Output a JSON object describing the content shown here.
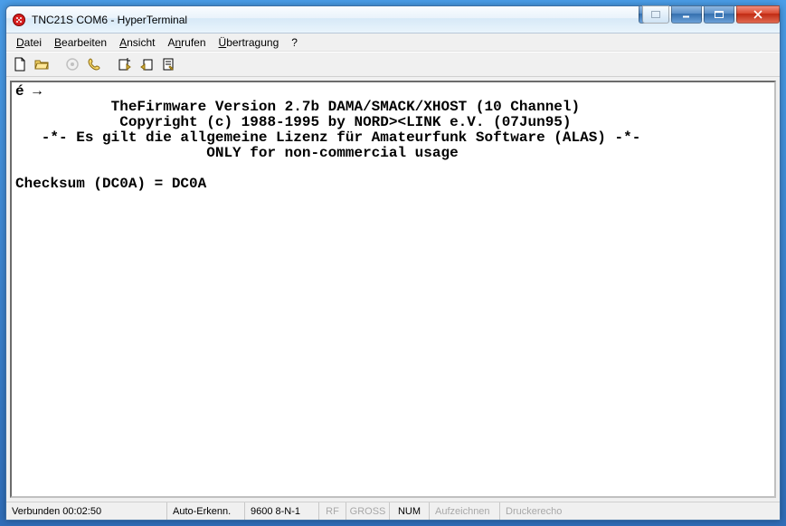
{
  "window": {
    "title": "TNC21S COM6 - HyperTerminal"
  },
  "menu": {
    "datei": "Datei",
    "bearbeiten": "Bearbeiten",
    "ansicht": "Ansicht",
    "anrufen": "Anrufen",
    "uebertragung": "Übertragung",
    "help": "?"
  },
  "toolbar_icons": {
    "new": "new-file-icon",
    "open": "open-folder-icon",
    "connect": "connect-icon",
    "disconnect": "phone-icon",
    "send": "send-file-icon",
    "receive": "receive-file-icon",
    "properties": "properties-icon"
  },
  "terminal": {
    "line1": "é →",
    "line2": "           TheFirmware Version 2.7b DAMA/SMACK/XHOST (10 Channel)",
    "line3": "            Copyright (c) 1988-1995 by NORD><LINK e.V. (07Jun95)",
    "line4": "   -*- Es gilt die allgemeine Lizenz für Amateurfunk Software (ALAS) -*-",
    "line5": "                      ONLY for non-commercial usage",
    "line6": "",
    "line7": "Checksum (DC0A) = DC0A"
  },
  "status": {
    "connection": "Verbunden 00:02:50",
    "detect": "Auto-Erkenn.",
    "baud": "9600 8-N-1",
    "rf": "RF",
    "caps": "GROSS",
    "num": "NUM",
    "record": "Aufzeichnen",
    "echo": "Druckerecho"
  }
}
